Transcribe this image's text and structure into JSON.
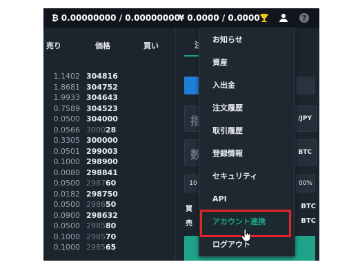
{
  "topbar": {
    "btc_symbol": "₿",
    "btc_balance": "0.00000000 / 0.00000000",
    "jpy_symbol": "¥",
    "jpy_balance": "0.0000 / 0.0000"
  },
  "orderbook": {
    "headers": {
      "sell": "売り",
      "price": "価格",
      "buy": "買い"
    },
    "rows": [
      {
        "qty": "1.1402",
        "price_main": "304816",
        "price_dim": ""
      },
      {
        "qty": "1.8681",
        "price_main": "304752",
        "price_dim": ""
      },
      {
        "qty": "1.9933",
        "price_main": "304643",
        "price_dim": ""
      },
      {
        "qty": "0.7589",
        "price_main": "304523",
        "price_dim": ""
      },
      {
        "qty": "0.0500",
        "price_main": "304000",
        "price_dim": ""
      },
      {
        "qty": "0.0566",
        "price_dim": "3000",
        "price_main": "28"
      },
      {
        "qty": "0.3305",
        "price_main": "300000",
        "price_dim": ""
      },
      {
        "qty": "0.0501",
        "price_main": "299003",
        "price_dim": ""
      },
      {
        "qty": "0.1000",
        "price_main": "298900",
        "price_dim": ""
      },
      {
        "qty": "0.0080",
        "price_main": "298841",
        "price_dim": ""
      },
      {
        "qty": "0.0500",
        "price_dim": "2987",
        "price_main": "60"
      },
      {
        "qty": "0.0182",
        "price_main": "298750",
        "price_dim": ""
      },
      {
        "qty": "0.0500",
        "price_dim": "2986",
        "price_main": "50"
      },
      {
        "qty": "0.0900",
        "price_main": "298632",
        "price_dim": ""
      },
      {
        "qty": "0.0500",
        "price_dim": "2985",
        "price_main": "80"
      },
      {
        "qty": "0.1000",
        "price_dim": "2985",
        "price_main": "70"
      },
      {
        "qty": "0.1000",
        "price_dim": "2985",
        "price_main": "65"
      }
    ]
  },
  "panel": {
    "tab_partial": "注",
    "price_label": "指",
    "price_unit": "/JPY",
    "amount_label": "数",
    "amount_unit": "BTC",
    "pct_left": "10",
    "pct_right": "00%",
    "buy_partial": "買",
    "buy_unit": "BTC",
    "sell_partial": "売",
    "sell_unit": "BTC"
  },
  "menu": {
    "items": [
      "お知らせ",
      "資産",
      "入出金",
      "注文履歴",
      "取引履歴",
      "登録情報",
      "セキュリティ",
      "API",
      "アカウント連携",
      "ログアウト"
    ],
    "highlighted_index": 8
  },
  "colors": {
    "accent_teal": "#1ea38a",
    "highlight_red": "#e6252a",
    "trophy_gold": "#f5c518",
    "blue_button": "#1e7fd6"
  }
}
